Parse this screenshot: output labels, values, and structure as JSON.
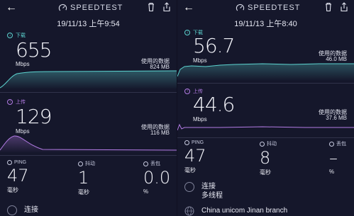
{
  "left": {
    "title": "SPEEDTEST",
    "timestamp": "19/11/13 上午9:54",
    "download": {
      "label": "下载",
      "value": "655",
      "unit": "Mbps",
      "data_label": "使用的数据",
      "data_value": "824 MB"
    },
    "upload": {
      "label": "上传",
      "value": "129",
      "unit": "Mbps",
      "data_label": "使用的数据",
      "data_value": "116 MB"
    },
    "ping": {
      "label": "PING",
      "value": "47",
      "unit": "毫秒"
    },
    "jitter": {
      "label": "抖动",
      "value": "1",
      "unit": "毫秒"
    },
    "loss": {
      "label": "丢包",
      "value": "0.0",
      "unit": "%"
    },
    "connection": {
      "label": "连接"
    }
  },
  "right": {
    "title": "SPEEDTEST",
    "timestamp": "19/11/13 上午8:40",
    "download": {
      "label": "下载",
      "value": "56.7",
      "unit": "Mbps",
      "data_label": "使用的数据",
      "data_value": "46.0 MB"
    },
    "upload": {
      "label": "上传",
      "value": "44.6",
      "unit": "Mbps",
      "data_label": "使用的数据",
      "data_value": "37.6 MB"
    },
    "ping": {
      "label": "PING",
      "value": "47",
      "unit": "毫秒"
    },
    "jitter": {
      "label": "抖动",
      "value": "8",
      "unit": "毫秒"
    },
    "loss": {
      "label": "丢包",
      "value": "–",
      "unit": "%"
    },
    "connection": {
      "label": "连接",
      "value": "多线程"
    },
    "server": {
      "value": "China unicom Jinan branch"
    }
  },
  "colors": {
    "download": "#5cd2cf",
    "upload": "#b47ce6",
    "background": "#15172b"
  },
  "icons": [
    "back-arrow-icon",
    "speedtest-logo-icon",
    "trash-icon",
    "share-icon",
    "download-icon",
    "upload-icon",
    "ping-icon",
    "jitter-icon",
    "loss-icon",
    "connection-icon",
    "globe-icon"
  ]
}
